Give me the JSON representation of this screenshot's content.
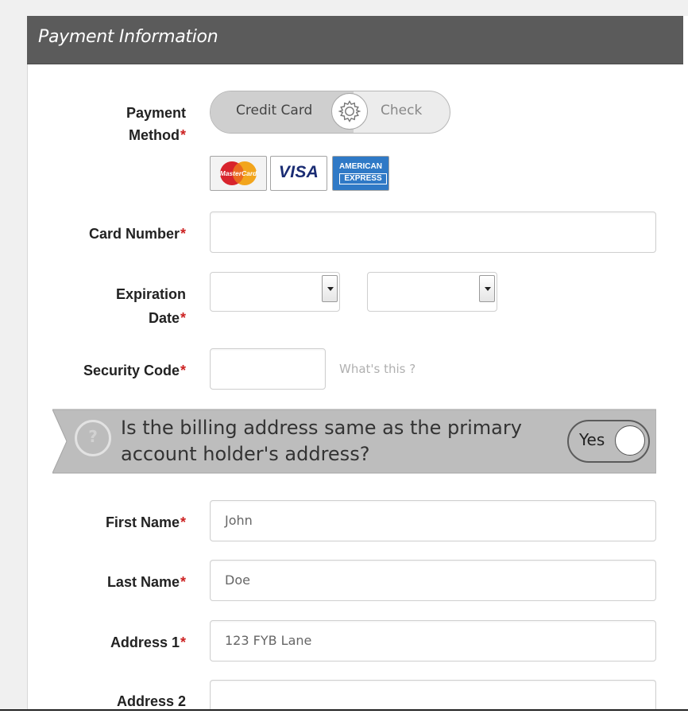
{
  "panel": {
    "title": "Payment Information"
  },
  "payment_method": {
    "label": "Payment",
    "label_line2": "Method",
    "required_marker": "*",
    "options": [
      "Credit Card",
      "Check"
    ],
    "selected": "Credit Card",
    "toggle_icon": "gear-icon",
    "accepted_cards": [
      {
        "name": "MasterCard",
        "icon": "mastercard-icon",
        "text": "MasterCard"
      },
      {
        "name": "VISA",
        "icon": "visa-icon",
        "text": "VISA"
      },
      {
        "name": "American Express",
        "icon": "amex-icon",
        "text_line1": "AMERICAN",
        "text_line2": "EXPRESS"
      }
    ]
  },
  "card_number": {
    "label": "Card Number",
    "required_marker": "*",
    "value": ""
  },
  "expiration": {
    "label_line1": "Expiration",
    "label_line2": "Date",
    "required_marker": "*",
    "month_value": "",
    "year_value": ""
  },
  "security_code": {
    "label": "Security Code",
    "required_marker": "*",
    "value": "",
    "help_link": "What's this ?"
  },
  "billing_same": {
    "question_line1": "Is the billing address same as the primary",
    "question_line2": "account holder's address?",
    "toggle_label": "Yes",
    "help_icon": "question-icon"
  },
  "first_name": {
    "label": "First Name",
    "required_marker": "*",
    "value": "John"
  },
  "last_name": {
    "label": "Last Name",
    "required_marker": "*",
    "value": "Doe"
  },
  "address1": {
    "label": "Address 1",
    "required_marker": "*",
    "value": "123 FYB Lane"
  },
  "address2": {
    "label": "Address 2",
    "value": ""
  },
  "colors": {
    "header_bg": "#5b5b5b",
    "required": "#cc2222",
    "banner_bg": "#bdbdbd",
    "field_border": "#cfcfcf"
  }
}
